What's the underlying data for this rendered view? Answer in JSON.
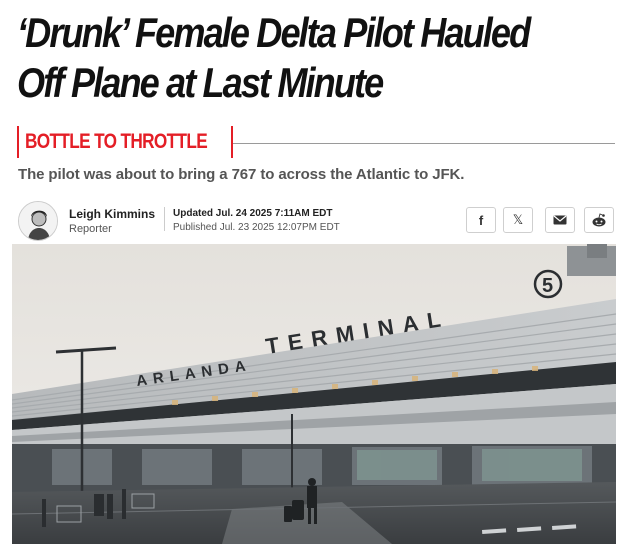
{
  "article": {
    "headline": "‘Drunk’ Female Delta Pilot Hauled Off Plane at Last Minute",
    "kicker": "BOTTLE TO THROTTLE",
    "deck": "The pilot was about to bring a 767 to across the Atlantic to JFK."
  },
  "byline": {
    "author_name": "Leigh Kimmins",
    "author_role": "Reporter",
    "updated": "Updated Jul. 24 2025 7:11AM EDT",
    "published": "Published Jul. 23 2025 12:07PM EDT"
  },
  "share": {
    "facebook_icon": "f",
    "x_icon": "𝕏",
    "mail_icon": "mail-icon",
    "reddit_icon": "reddit-icon"
  },
  "hero_image": {
    "sign_text": "ARLANDA TERMINAL",
    "sign_number": "5",
    "colors": {
      "sky": "#e9e7e3",
      "building": "#bfc2c4",
      "ground": "#3e4246"
    }
  }
}
